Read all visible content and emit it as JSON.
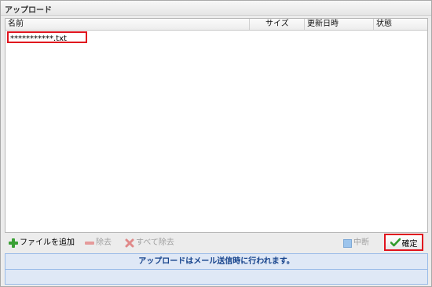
{
  "window": {
    "title": "アップロード"
  },
  "grid": {
    "columns": {
      "name": "名前",
      "size": "サイズ",
      "modified": "更新日時",
      "status": "状態"
    },
    "rows": [
      {
        "name": "***********.txt",
        "size": "",
        "modified": "",
        "status": ""
      }
    ]
  },
  "toolbar": {
    "add_label": "ファイルを追加",
    "remove_label": "除去",
    "remove_all_label": "すべて除去",
    "stop_label": "中断",
    "confirm_label": "確定"
  },
  "status": {
    "message": "アップロードはメール送信時に行われます。"
  },
  "colors": {
    "highlight": "#e0141e",
    "add_icon": "#3aa035",
    "status_text": "#15428b",
    "status_bg": "#dfe8f6"
  }
}
